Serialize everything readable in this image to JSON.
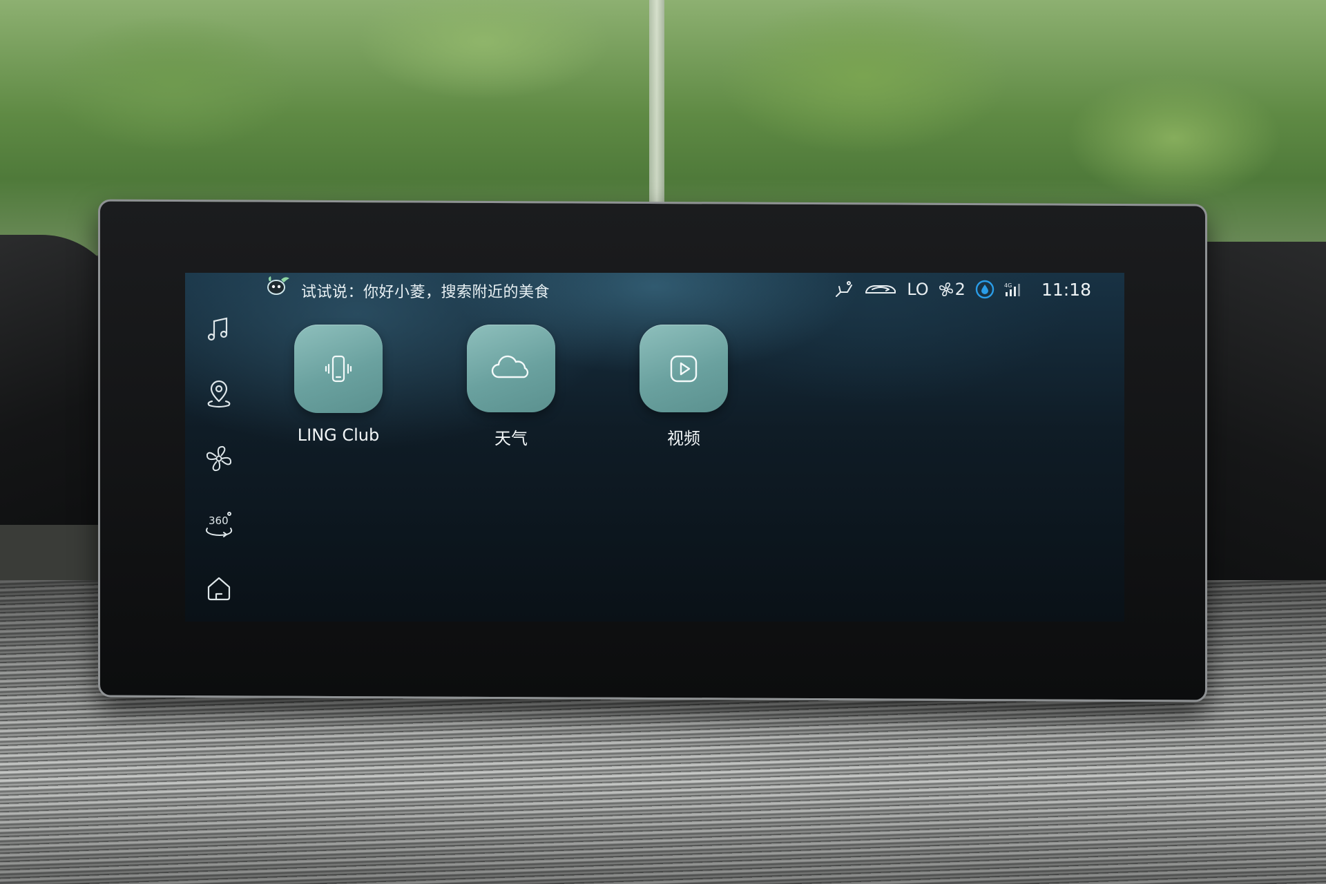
{
  "assistant": {
    "hint": "试试说：你好小菱，搜索附近的美食"
  },
  "status_bar": {
    "temperature": "LO",
    "fan_level": "2",
    "clock": "11:18",
    "icons": [
      "seat-icon",
      "car-recirculation-icon",
      "fan-icon",
      "water-drop-icon",
      "signal-4g-icon"
    ]
  },
  "sidebar": {
    "items": [
      {
        "id": "music",
        "icon": "music-note-icon"
      },
      {
        "id": "navigation",
        "icon": "location-pin-icon"
      },
      {
        "id": "climate",
        "icon": "fan-icon"
      },
      {
        "id": "camera-360",
        "icon": "camera-360-icon",
        "label": "360"
      },
      {
        "id": "home",
        "icon": "home-icon"
      }
    ]
  },
  "apps": [
    {
      "label": "LING Club",
      "icon": "phone-vibrate-icon"
    },
    {
      "label": "天气",
      "icon": "cloud-icon"
    },
    {
      "label": "视频",
      "icon": "play-icon"
    }
  ],
  "colors": {
    "tile": "#6fa5a3",
    "screen_bg": "#0f1c26",
    "accent_drop": "#2a9de8"
  }
}
